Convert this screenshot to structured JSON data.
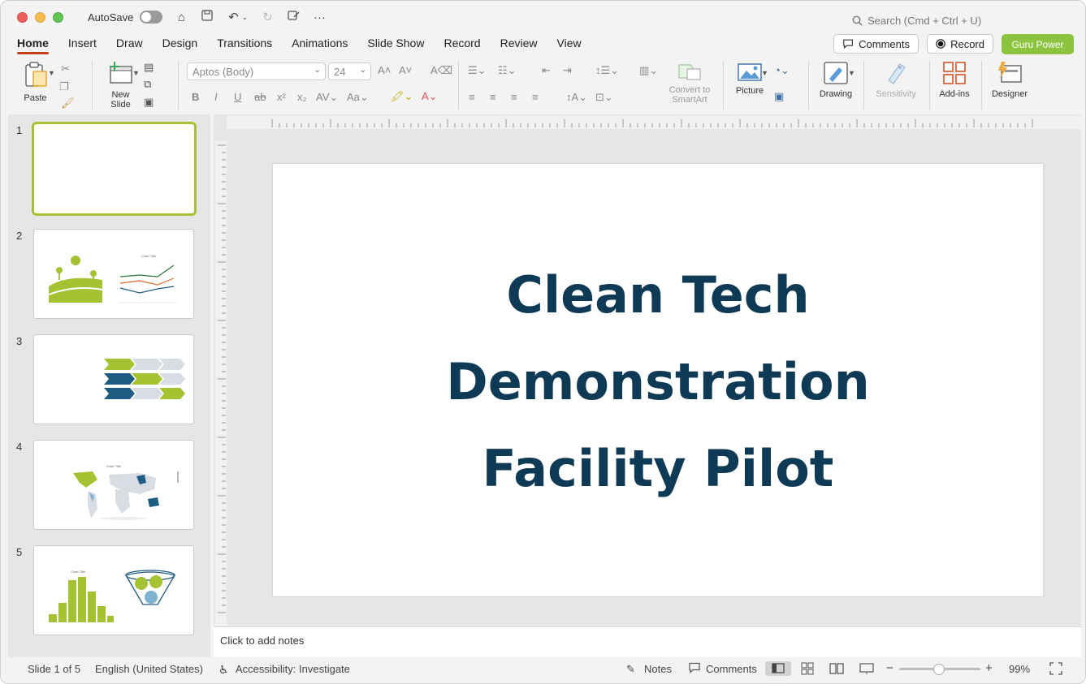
{
  "titlebar": {
    "autosave_label": "AutoSave",
    "search_placeholder": "Search (Cmd + Ctrl + U)"
  },
  "tabs": [
    {
      "label": "Home",
      "active": true
    },
    {
      "label": "Insert"
    },
    {
      "label": "Draw"
    },
    {
      "label": "Design"
    },
    {
      "label": "Transitions"
    },
    {
      "label": "Animations"
    },
    {
      "label": "Slide Show"
    },
    {
      "label": "Record"
    },
    {
      "label": "Review"
    },
    {
      "label": "View"
    }
  ],
  "ribbon_right": {
    "comments_label": "Comments",
    "record_label": "Record",
    "guru_label": "Guru Power"
  },
  "ribbon": {
    "paste_label": "Paste",
    "new_slide_label_1": "New",
    "new_slide_label_2": "Slide",
    "font_name": "Aptos (Body)",
    "font_size": "24",
    "smartart_label_1": "Convert to",
    "smartart_label_2": "SmartArt",
    "picture_label": "Picture",
    "drawing_label": "Drawing",
    "sensitivity_label": "Sensitivity",
    "addins_label": "Add-ins",
    "designer_label": "Designer"
  },
  "thumbnails": [
    {
      "number": "1",
      "selected": true
    },
    {
      "number": "2"
    },
    {
      "number": "3"
    },
    {
      "number": "4"
    },
    {
      "number": "5"
    }
  ],
  "thumb2_chart_title": "Chart Title",
  "thumb4_chart_title": "Chart Title",
  "thumb5_chart_title": "Chart Title",
  "slide": {
    "title_line_1": "Clean Tech",
    "title_line_2": "Demonstration",
    "title_line_3": "Facility Pilot"
  },
  "notes_placeholder": "Click to add notes",
  "status": {
    "slide_counter": "Slide 1 of 5",
    "language": "English (United States)",
    "accessibility": "Accessibility: Investigate",
    "notes_label": "Notes",
    "comments_label": "Comments",
    "zoom": "99%"
  },
  "colors": {
    "accent_green": "#a5c232",
    "title_navy": "#0e3a55",
    "tab_underline": "#c43e1c"
  }
}
